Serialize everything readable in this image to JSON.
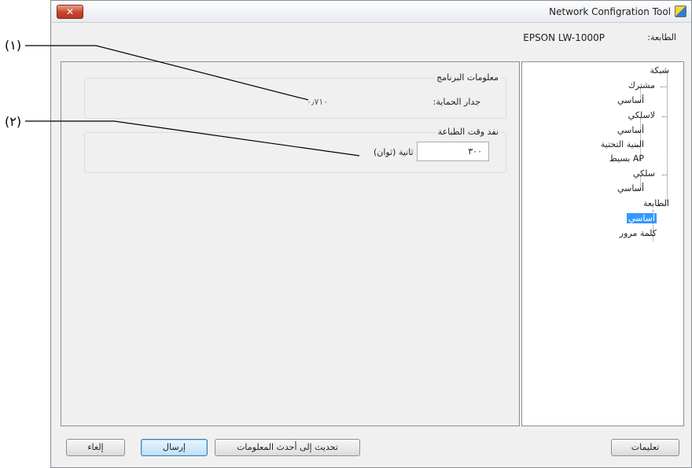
{
  "window": {
    "title": "Network Configration Tool",
    "close_label": "✕"
  },
  "printer": {
    "label": "الطابعة:",
    "value": "EPSON LW-1000P"
  },
  "main": {
    "software_group": {
      "title": "معلومات البرنامج",
      "firmware_label": "جدار الحماية:",
      "firmware_value": "٠٫٧١٠"
    },
    "timeout_group": {
      "title": "نفد وقت الطباعة",
      "value": "٣٠٠",
      "unit": "ثانية (ثوان)"
    }
  },
  "tree": {
    "items": [
      "شبكة",
      "مشترك",
      "أساسي",
      "لاسلكي",
      "أساسي",
      "البنية التحتية",
      "AP بسيط",
      "سلكي",
      "أساسي",
      "الطابعة",
      "أساسي",
      "كلمة مرور"
    ]
  },
  "buttons": {
    "help": "تعليمات",
    "update": "تحديث إلى أحدث المعلومات",
    "send": "إرسال",
    "cancel": "إلغاء"
  },
  "callouts": {
    "one": "(١)",
    "two": "(٢)"
  },
  "colors": {
    "selected_bg": "#3399ff",
    "close_button": "#c9442a"
  }
}
